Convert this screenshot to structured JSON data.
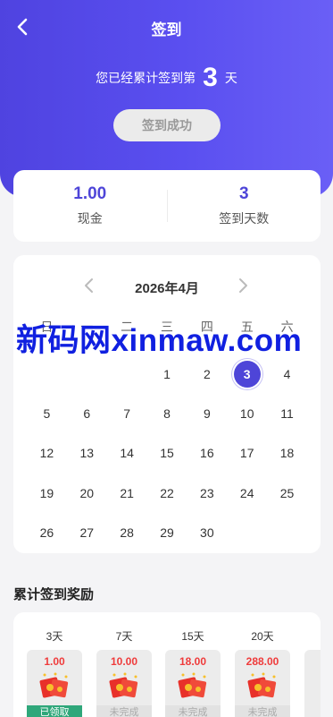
{
  "header": {
    "title": "签到",
    "streak_prefix": "您已经累计签到第",
    "streak_days": "3",
    "streak_suffix": "天",
    "sign_button": "签到成功"
  },
  "stats": [
    {
      "value": "1.00",
      "label": "现金"
    },
    {
      "value": "3",
      "label": "签到天数"
    }
  ],
  "calendar": {
    "month": "2026年4月",
    "weekdays": [
      "日",
      "一",
      "二",
      "三",
      "四",
      "五",
      "六"
    ],
    "days": [
      "1",
      "2",
      "3",
      "4",
      "5",
      "6",
      "7",
      "8",
      "9",
      "10",
      "11",
      "12",
      "13",
      "14",
      "15",
      "16",
      "17",
      "18",
      "19",
      "20",
      "21",
      "22",
      "23",
      "24",
      "25",
      "26",
      "27",
      "28",
      "29",
      "30"
    ],
    "today": "3"
  },
  "watermark": "新码网xinmaw.com",
  "rewards": {
    "title": "累计签到奖励",
    "items": [
      {
        "day": "3天",
        "amount": "1.00",
        "status": "已领取"
      },
      {
        "day": "7天",
        "amount": "10.00",
        "status": "未完成"
      },
      {
        "day": "15天",
        "amount": "18.00",
        "status": "未完成"
      },
      {
        "day": "20天",
        "amount": "288.00",
        "status": "未完成"
      }
    ]
  },
  "colors": {
    "accent": "#4e45d8",
    "reward_red": "#ef3b3b",
    "claimed_green": "#2fa77a"
  }
}
